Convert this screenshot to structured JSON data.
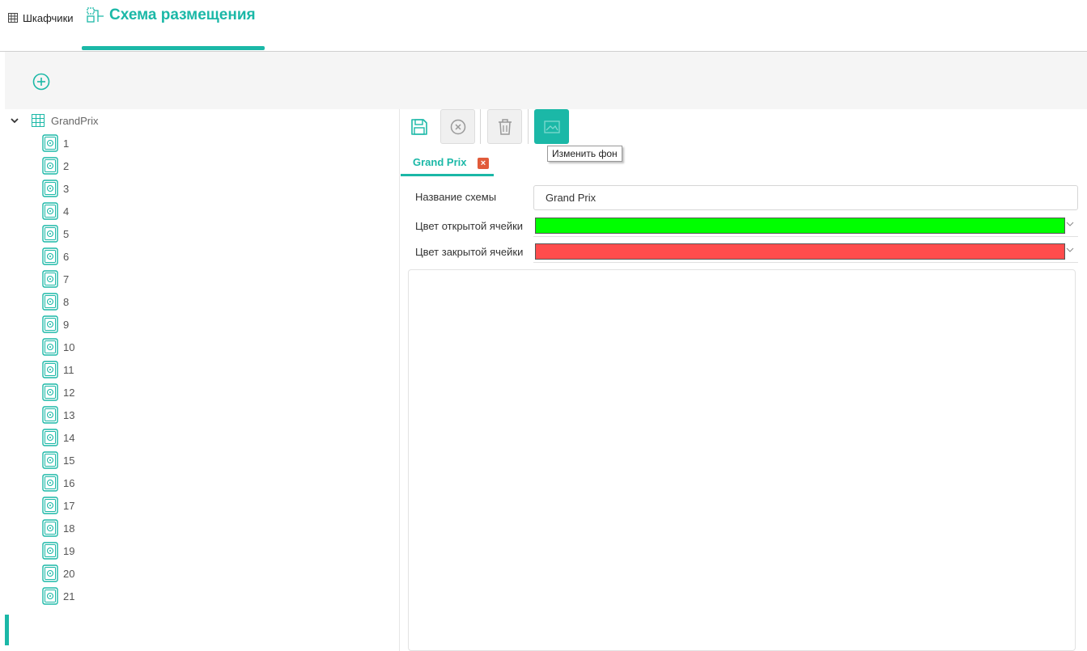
{
  "header": {
    "tab_lockers": "Шкафчики",
    "tab_scheme": "Схема размещения"
  },
  "tree": {
    "root": "GrandPrix",
    "items": [
      "1",
      "2",
      "3",
      "4",
      "5",
      "6",
      "7",
      "8",
      "9",
      "10",
      "11",
      "12",
      "13",
      "14",
      "15",
      "16",
      "17",
      "18",
      "19",
      "20",
      "21"
    ]
  },
  "toolbar": {
    "tooltip": "Изменить фон"
  },
  "document": {
    "tab_label": "Grand Prix",
    "name_label": "Название схемы",
    "name_value": "Grand Prix",
    "open_color_label": "Цвет открытой ячейки",
    "open_color": "#00ff00",
    "closed_color_label": "Цвет закрытой ячейки",
    "closed_color": "#ff4c4c"
  },
  "colors": {
    "accent": "#1bb8a7",
    "close_badge": "#e15b3a"
  }
}
